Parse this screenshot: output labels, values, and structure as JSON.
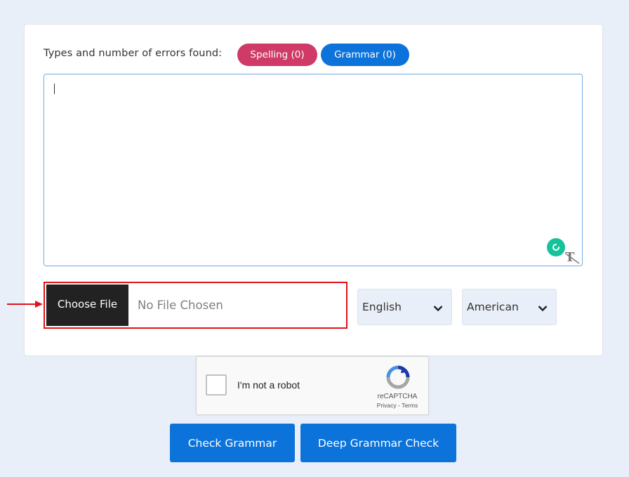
{
  "errors": {
    "label": "Types and number of errors found:",
    "spelling_label": "Spelling (0)",
    "grammar_label": "Grammar (0)",
    "spelling_color": "#cf3a67",
    "grammar_color": "#0c73db"
  },
  "editor": {
    "value": ""
  },
  "file_upload": {
    "button_label": "Choose File",
    "status": "No File Chosen",
    "highlight_color": "#e0121b"
  },
  "language_select": {
    "selected": "English"
  },
  "variant_select": {
    "selected": "American"
  },
  "captcha": {
    "label": "I'm not a robot",
    "brand": "reCAPTCHA",
    "privacy": "Privacy",
    "separator": " - ",
    "terms": "Terms"
  },
  "actions": {
    "check_label": "Check Grammar",
    "deep_label": "Deep Grammar Check",
    "color": "#0c73db"
  },
  "icons": [
    "grammarly-icon",
    "text-format-icon",
    "arrow-right-icon",
    "chevron-down-icon",
    "recaptcha-logo-icon"
  ]
}
